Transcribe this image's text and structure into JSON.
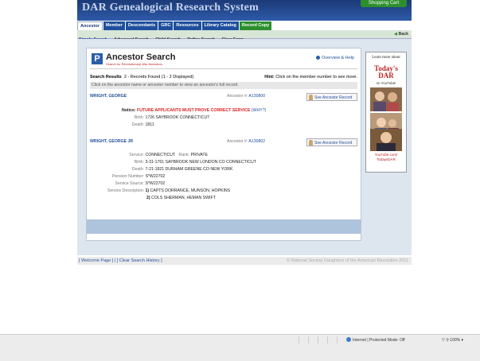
{
  "header": {
    "site_title": "DAR Genealogical Research System",
    "cart_label": "Shopping Cart"
  },
  "tabs": [
    {
      "label": "Ancestor"
    },
    {
      "label": "Member"
    },
    {
      "label": "Descendants"
    },
    {
      "label": "GRC"
    },
    {
      "label": "Resources"
    },
    {
      "label": "Library Catalog"
    },
    {
      "label": "Record Copy"
    }
  ],
  "subnav": {
    "items": [
      {
        "label": "Simple Search"
      },
      {
        "label": "Advanced Search"
      },
      {
        "label": "Child Search"
      },
      {
        "label": "Refine Search"
      },
      {
        "label": "Clear Form"
      }
    ],
    "back_label": "Back"
  },
  "panel": {
    "title": "Ancestor Search",
    "subtitle": "Search for Revolutionary War Ancestors",
    "overview_label": "Overview & Help",
    "results_label": "Search Results",
    "results_text": "2 - Records Found (1 - 2 Displayed)",
    "hint_label": "Hint:",
    "hint_text": "Click on the member number to see more.",
    "strip_text": "Click on the ancestor name or ancestor number to view an ancestor's full record."
  },
  "records": [
    {
      "name": "WRIGHT, GEORGE",
      "anc_label": "Ancestor #:",
      "anc_number": "A130800",
      "see_label": "See Ancestor Record",
      "notice_label": "Notice:",
      "notice_text": "FUTURE APPLICANTS MUST PROVE CORRECT SERVICE",
      "notice_link": "(WHY?)",
      "birth_label": "Birth:",
      "birth_value": "1726   SAYBROOK CONNECTICUT",
      "death_label": "Death:",
      "death_value": "1811"
    },
    {
      "name": "WRIGHT, GEORGE JR",
      "anc_label": "Ancestor #:",
      "anc_number": "A130802",
      "see_label": "See Ancestor Record",
      "service_label": "Service:",
      "service_value": "CONNECTICUT",
      "rank_label": "Rank:",
      "rank_value": "PRIVATE",
      "birth_label": "Birth:",
      "birth_value": "3-31-1761   SAYBROOK NEW LONDON CO CONNECTICUT",
      "death_label": "Death:",
      "death_value": "7-21-1821   DURHAM GREENE CO NEW YORK",
      "pension_label": "Pension Number:",
      "pension_value": "S*W22702",
      "source_label": "Service Source:",
      "source_value": "S*W22702",
      "desc_label": "Service Description:",
      "desc_items": [
        {
          "num": "1)",
          "text": "CAPTS DORRANCE, MUNSON, HOPKINS"
        },
        {
          "num": "2)",
          "text": "COLS SHERMAN, HEMAN SWIFT"
        }
      ]
    }
  ],
  "side_ad": {
    "line1": "Learn more about",
    "brand1": "Today's",
    "brand2": "DAR",
    "line2": "on YouTube!",
    "line3": "YouTube.com/",
    "line4": "TodaysDAR"
  },
  "footer": {
    "links": "[ Welcome Page ] | [ Clear Search History ]",
    "copyright": "© National Society Daughters of the American Revolution 2011"
  },
  "browser_status": {
    "zone": "Internet | Protected Mode: Off",
    "zoom": "100%"
  },
  "colors": {
    "header_blue": "#1b3a78",
    "accent_green": "#2c8f2c",
    "link_blue": "#1f4f9c",
    "notice_red": "#d22"
  }
}
